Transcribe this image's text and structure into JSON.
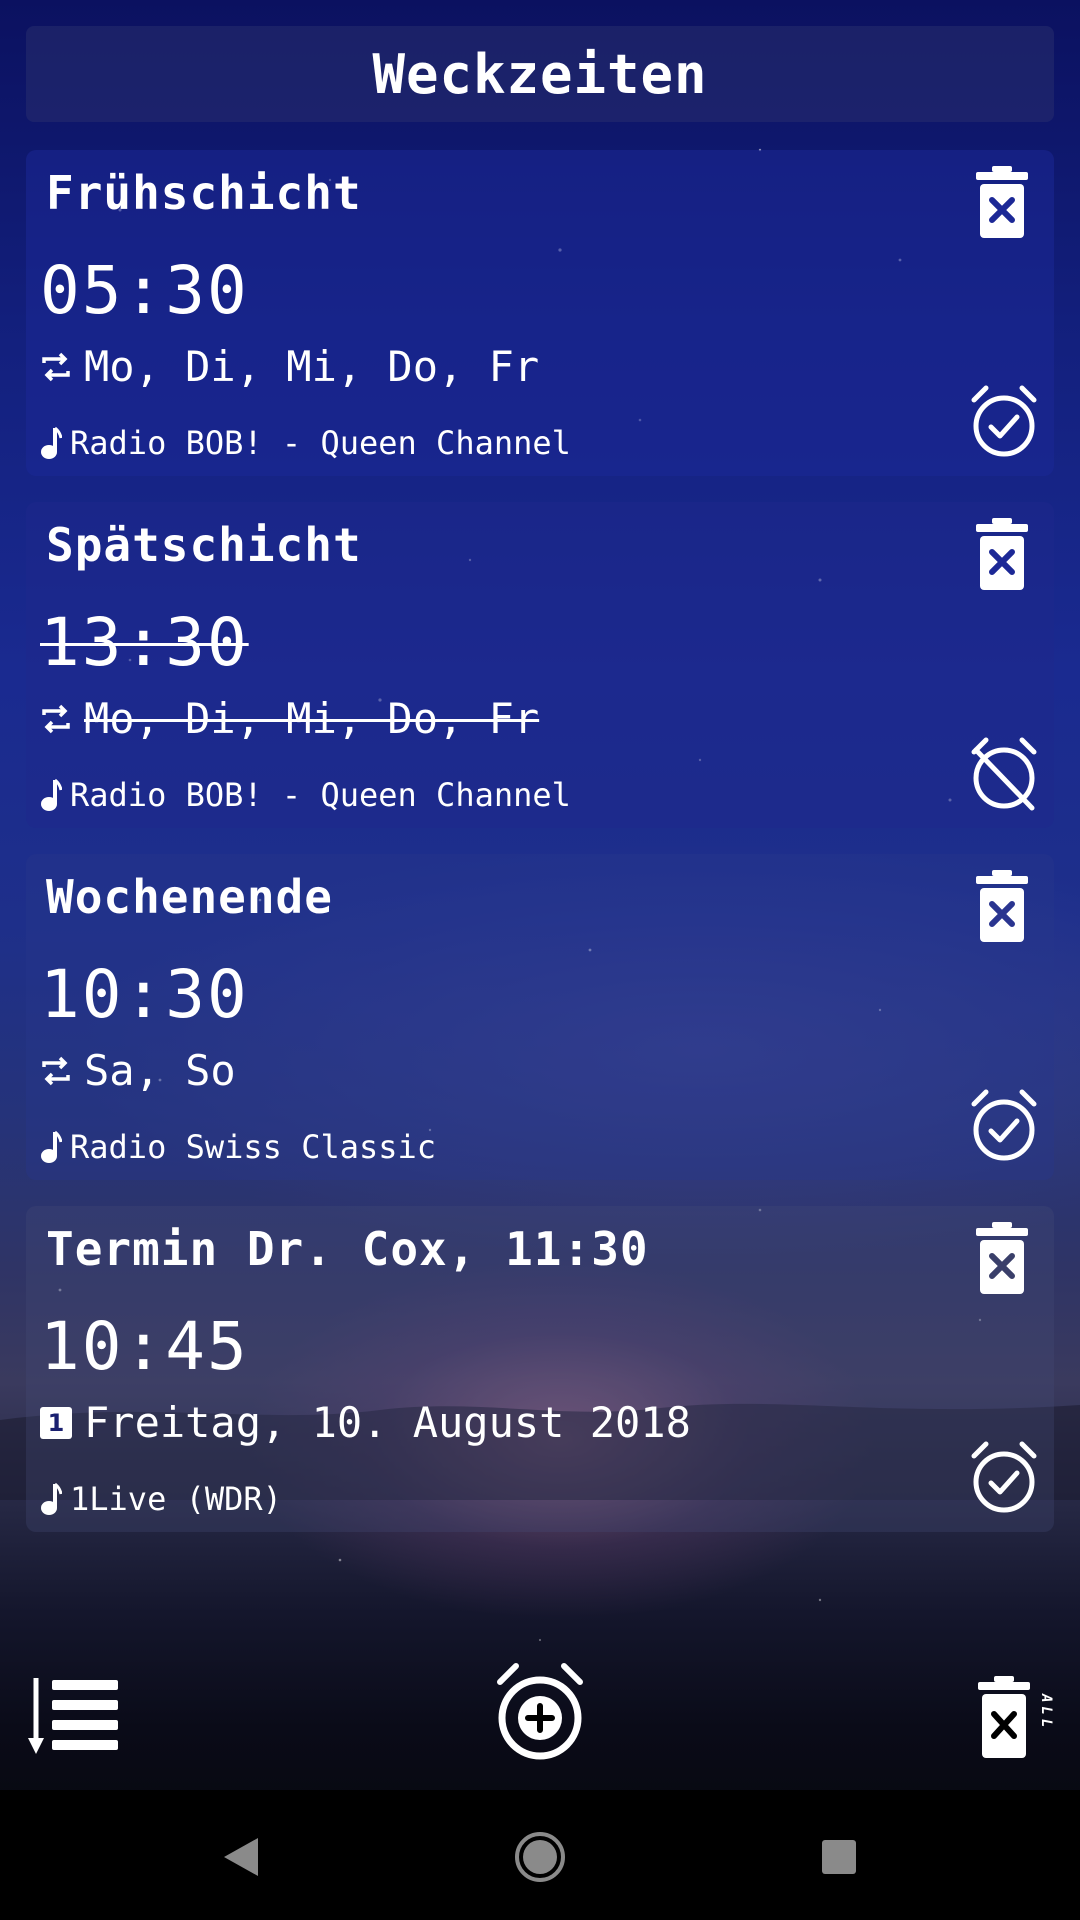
{
  "header": {
    "title": "Weckzeiten"
  },
  "alarms": [
    {
      "name": "Frühschicht",
      "time": "05:30",
      "schedule": "Mo, Di, Mi, Do, Fr",
      "schedule_type": "repeat",
      "sound": "Radio BOB! - Queen Channel",
      "enabled": true
    },
    {
      "name": "Spätschicht",
      "time": "13:30",
      "schedule": "Mo, Di, Mi, Do, Fr",
      "schedule_type": "repeat",
      "sound": "Radio BOB! - Queen Channel",
      "enabled": false
    },
    {
      "name": "Wochenende",
      "time": "10:30",
      "schedule": "Sa, So",
      "schedule_type": "repeat",
      "sound": "Radio Swiss Classic",
      "enabled": true
    },
    {
      "name": "Termin Dr. Cox, 11:30",
      "time": "10:45",
      "schedule": "Freitag, 10. August 2018",
      "schedule_type": "one-time",
      "schedule_badge": "1",
      "sound": "1Live (WDR)",
      "enabled": true
    }
  ],
  "toolbar": {
    "sort_icon": "sort-list-icon",
    "add_icon": "add-alarm-icon",
    "delete_all_icon": "delete-all-icon",
    "delete_all_label": "ALL"
  },
  "icons": {
    "delete": "trash-x-icon",
    "alarm_on": "alarm-check-icon",
    "alarm_off": "alarm-off-icon",
    "repeat": "repeat-icon",
    "music": "music-note-icon"
  },
  "colors": {
    "text": "#ffffff",
    "card_bg": "#1c2896",
    "nav_bg": "#000000"
  }
}
